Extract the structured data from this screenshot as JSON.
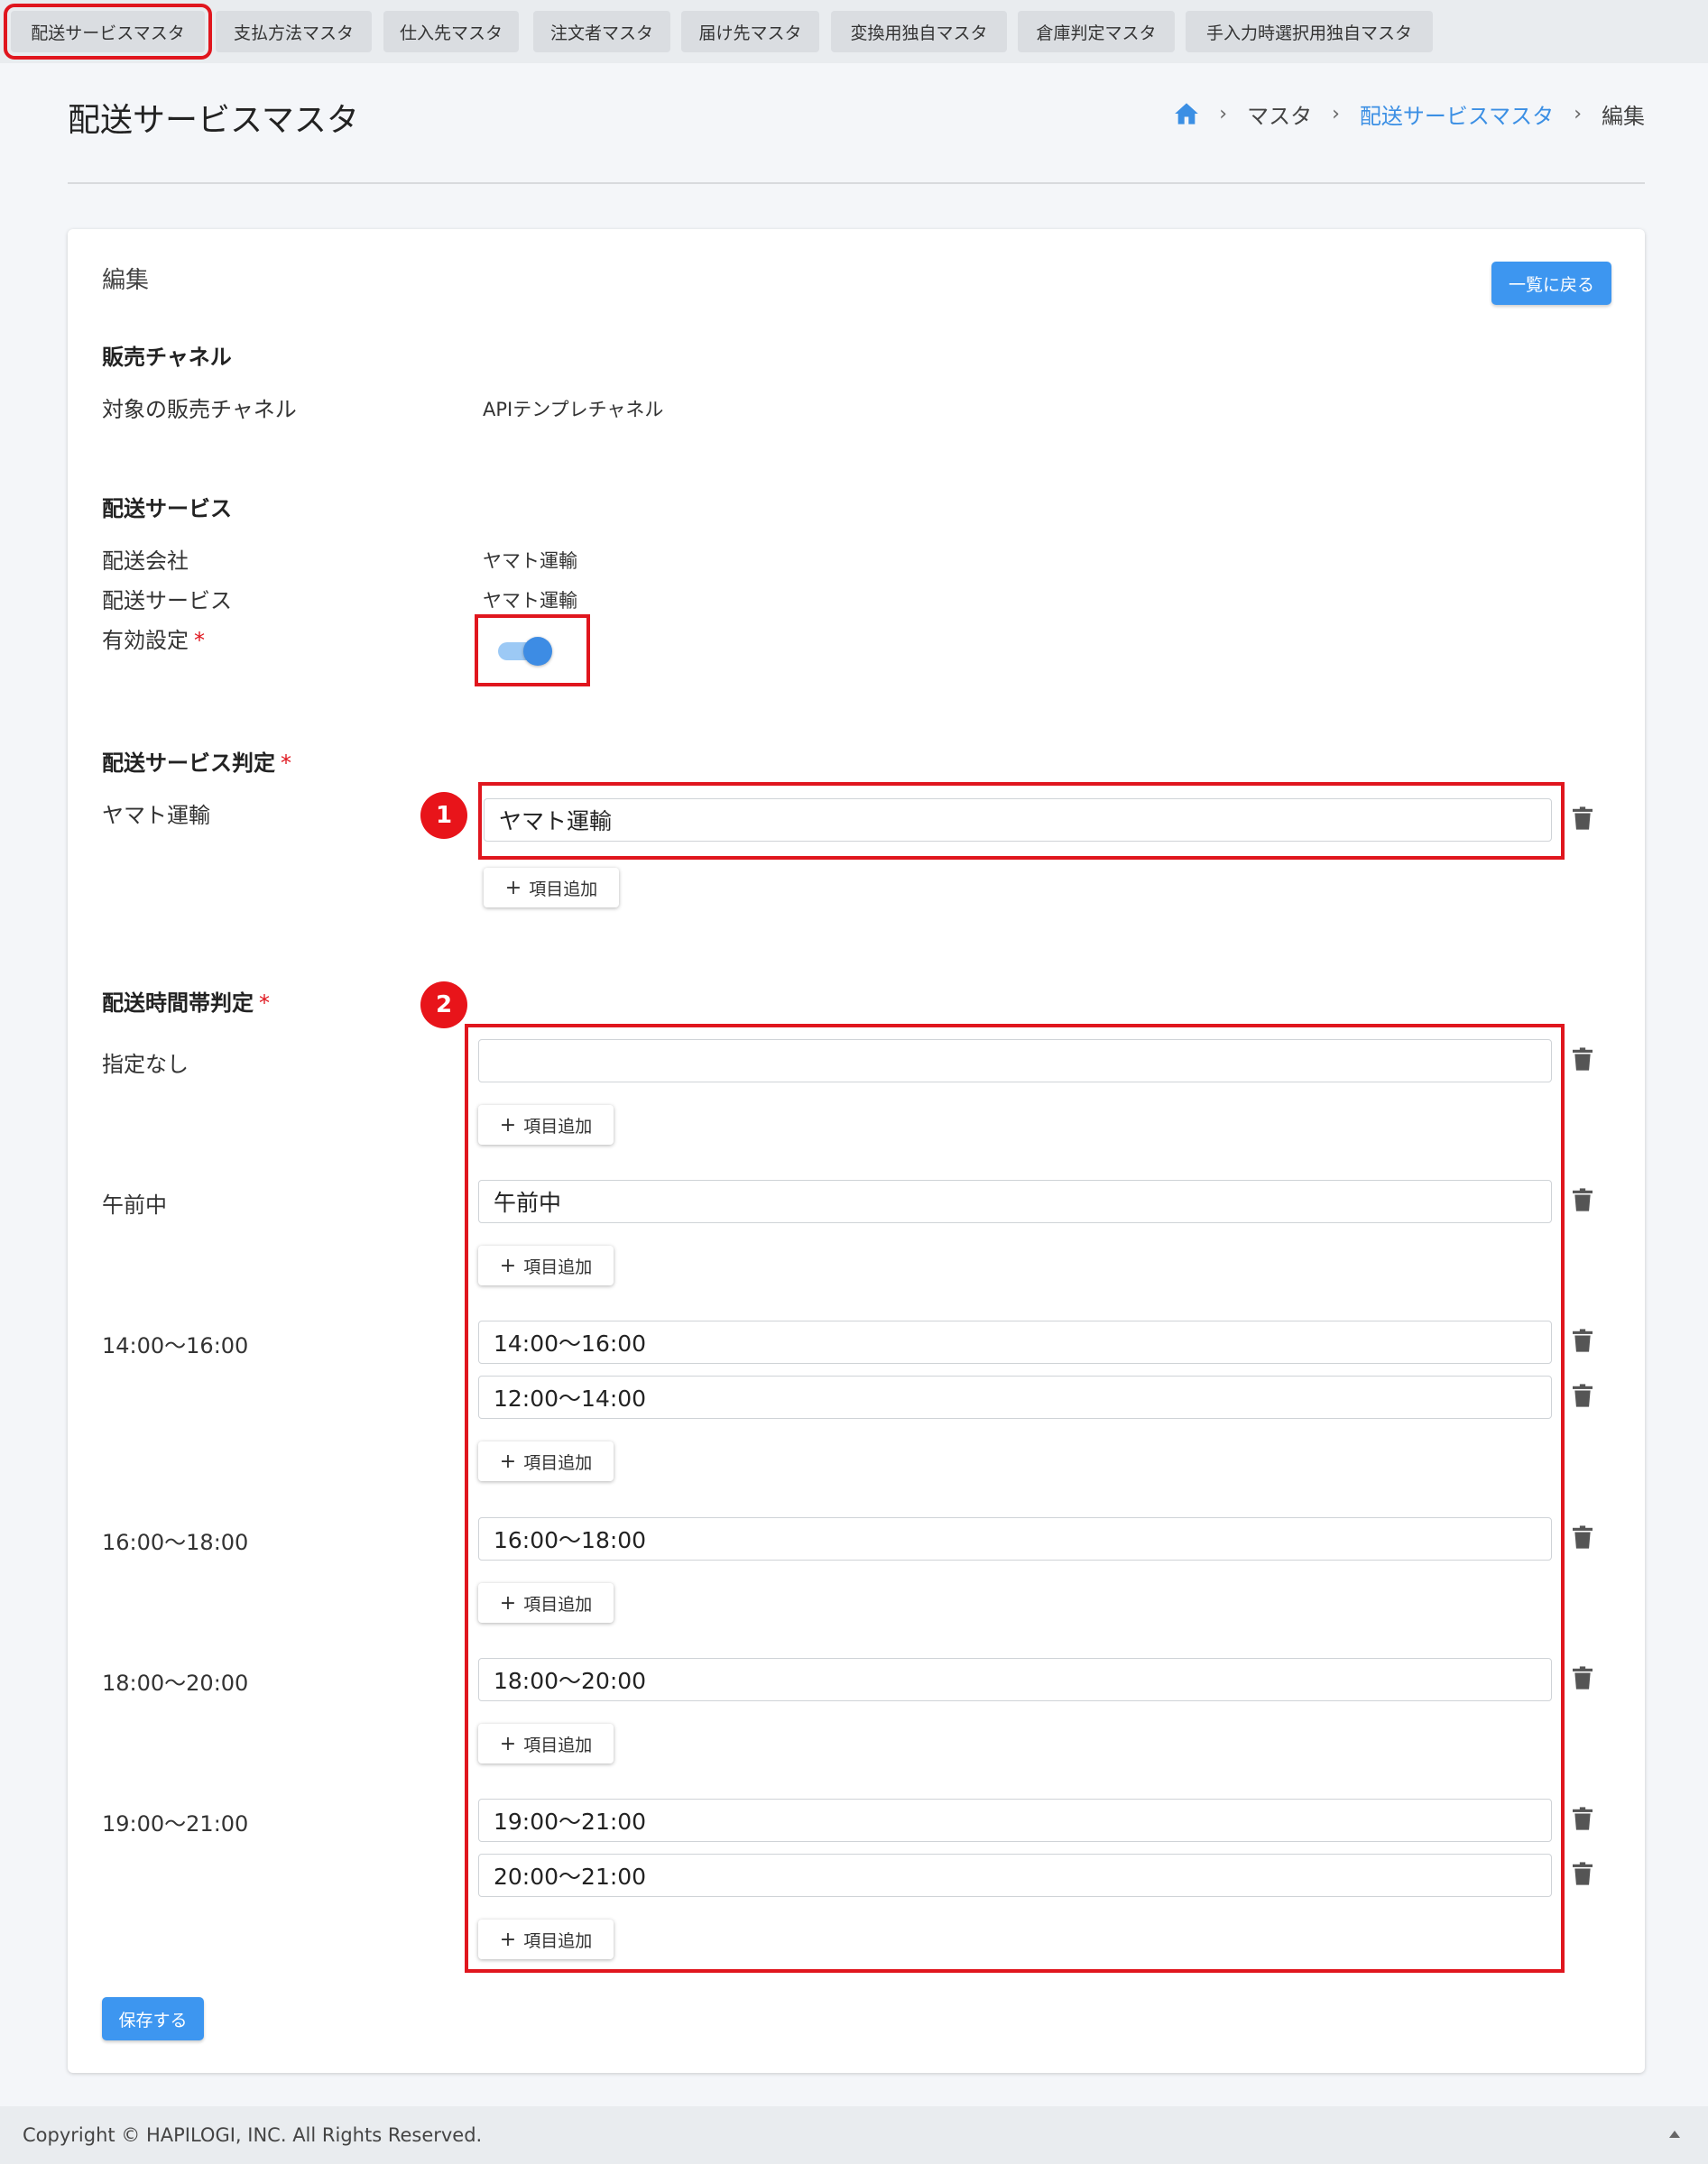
{
  "tabs": [
    {
      "label": "配送サービスマスタ",
      "active": true
    },
    {
      "label": "支払方法マスタ"
    },
    {
      "label": "仕入先マスタ"
    },
    {
      "label": "注文者マスタ"
    },
    {
      "label": "届け先マスタ"
    },
    {
      "label": "変換用独自マスタ"
    },
    {
      "label": "倉庫判定マスタ"
    },
    {
      "label": "手入力時選択用独自マスタ"
    }
  ],
  "header": {
    "title": "配送サービスマスタ",
    "breadcrumb": {
      "home_icon": "home-icon",
      "item1": "マスタ",
      "item2": "配送サービスマスタ",
      "item3": "編集",
      "separator": "›"
    }
  },
  "card": {
    "title": "編集",
    "back_button": "一覧に戻る",
    "sales_channel": {
      "heading": "販売チャネル",
      "label": "対象の販売チャネル",
      "value": "APIテンプレチャネル"
    },
    "delivery_service": {
      "heading": "配送サービス",
      "company_label": "配送会社",
      "company_value": "ヤマト運輸",
      "service_label": "配送サービス",
      "service_value": "ヤマト運輸",
      "enabled_label": "有効設定",
      "required_mark": "*",
      "enabled": true
    },
    "service_judgement": {
      "heading": "配送サービス判定",
      "required_mark": "*",
      "badge": "1",
      "label": "ヤマト運輸",
      "input_value": "ヤマト運輸",
      "add_label": "項目追加"
    },
    "time_judgement": {
      "heading": "配送時間帯判定",
      "required_mark": "*",
      "badge": "2",
      "add_label": "項目追加",
      "groups": [
        {
          "label": "指定なし",
          "inputs": [
            ""
          ]
        },
        {
          "label": "午前中",
          "inputs": [
            "午前中"
          ]
        },
        {
          "label": "14:00〜16:00",
          "inputs": [
            "14:00〜16:00",
            "12:00〜14:00"
          ]
        },
        {
          "label": "16:00〜18:00",
          "inputs": [
            "16:00〜18:00"
          ]
        },
        {
          "label": "18:00〜20:00",
          "inputs": [
            "18:00〜20:00"
          ]
        },
        {
          "label": "19:00〜21:00",
          "inputs": [
            "19:00〜21:00",
            "20:00〜21:00"
          ]
        }
      ]
    },
    "save_button": "保存する"
  },
  "footer": {
    "copyright": "Copyright © HAPILOGI, INC. All Rights Reserved."
  },
  "colors": {
    "primary": "#3d96f0",
    "annotation_red": "#e0161e",
    "link": "#3b8fe4"
  }
}
